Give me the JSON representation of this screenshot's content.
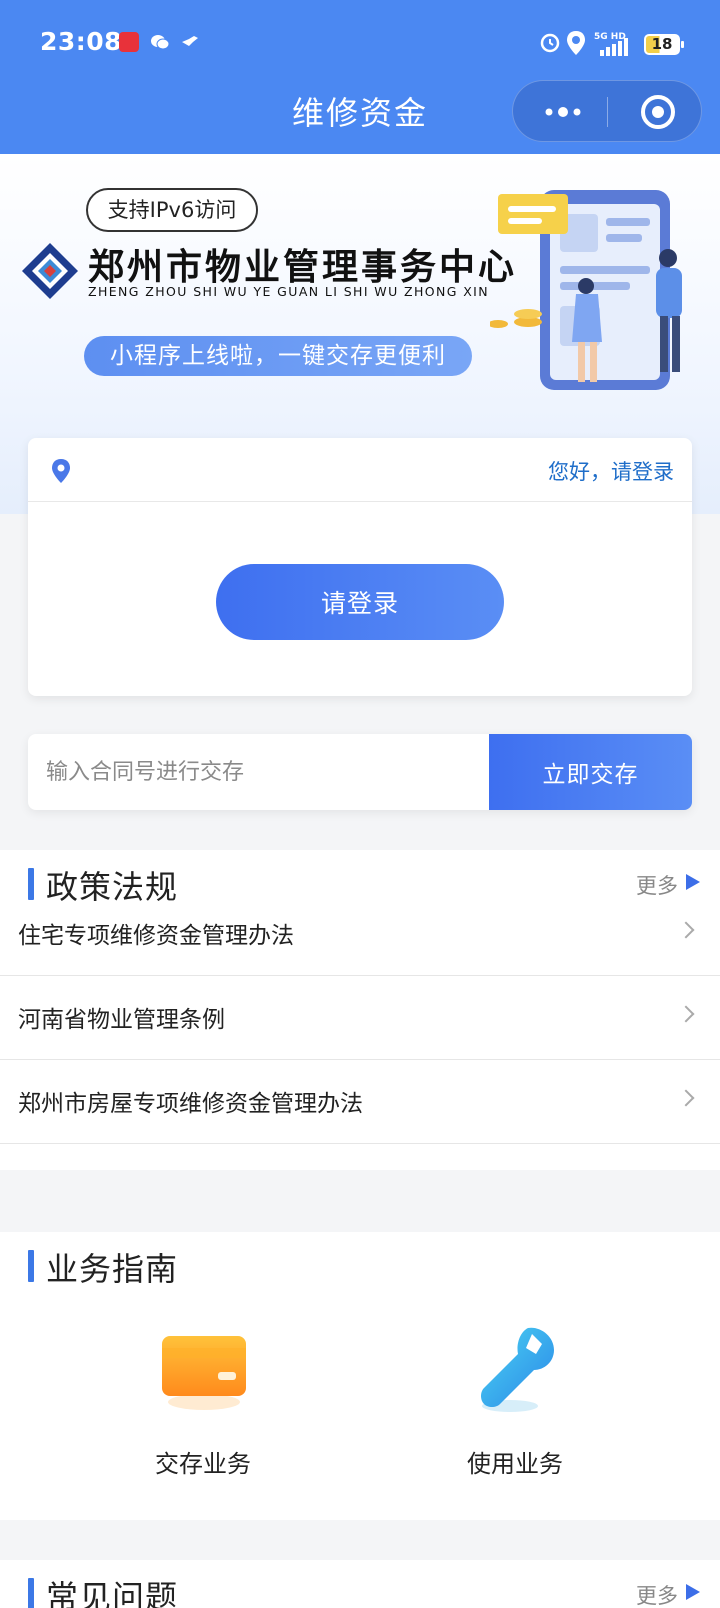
{
  "status_bar": {
    "time": "23:08",
    "network": "5G HD",
    "battery": "18"
  },
  "nav": {
    "title": "维修资金"
  },
  "banner": {
    "ipv6_badge": "支持IPv6访问",
    "org_name": "郑州市物业管理事务中心",
    "org_pinyin": "ZHENG ZHOU SHI WU YE GUAN LI SHI WU ZHONG XIN",
    "slogan": "小程序上线啦，一键交存更便利"
  },
  "login_card": {
    "greeting": "您好，请登录",
    "login_button": "请登录"
  },
  "contract": {
    "placeholder": "输入合同号进行交存",
    "button": "立即交存"
  },
  "policy": {
    "title": "政策法规",
    "more": "更多",
    "items": [
      {
        "label": "住宅专项维修资金管理办法"
      },
      {
        "label": "河南省物业管理条例"
      },
      {
        "label": "郑州市房屋专项维修资金管理办法"
      }
    ]
  },
  "guide": {
    "title": "业务指南",
    "items": [
      {
        "label": "交存业务",
        "icon": "card-icon"
      },
      {
        "label": "使用业务",
        "icon": "wrench-icon"
      }
    ]
  },
  "faq": {
    "title": "常见问题",
    "more": "更多"
  },
  "colors": {
    "header": "#4b88f2",
    "accent": "#3c78e6",
    "link": "#1f6ec9"
  }
}
